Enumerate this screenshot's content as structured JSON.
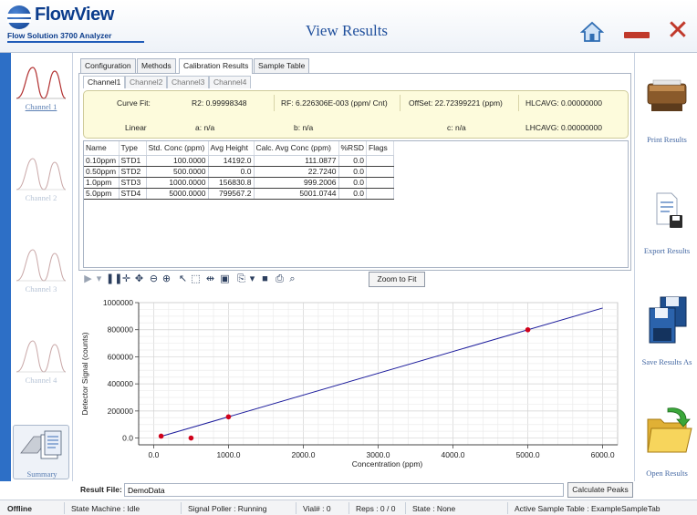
{
  "app": {
    "logo_name": "FlowView",
    "logo_subtitle": "Flow Solution 3700 Analyzer",
    "page_title": "View Results"
  },
  "left_sidebar": {
    "channels": [
      {
        "label": "Channel 1",
        "active": true
      },
      {
        "label": "Channel 2",
        "active": false
      },
      {
        "label": "Channel 3",
        "active": false
      },
      {
        "label": "Channel 4",
        "active": false
      }
    ],
    "summary_label": "Summary"
  },
  "right_sidebar": {
    "print_label": "Print Results",
    "export_label": "Export Results",
    "save_label": "Save Results As",
    "open_label": "Open Results"
  },
  "tabs": [
    "Configuration",
    "Methods",
    "Calibration Results",
    "Sample Table"
  ],
  "active_tab": "Calibration Results",
  "subtabs": [
    "Channel1",
    "Channel2",
    "Channel3",
    "Channel4"
  ],
  "active_subtab": "Channel1",
  "curve": {
    "curve_fit_label": "Curve Fit:",
    "curve_fit_value": "Linear",
    "r2": "R2: 0.99998348",
    "rf": "RF: 6.226306E-003 (ppm/ Cnt)",
    "offset": "OffSet: 22.72399221 (ppm)",
    "hlcavg": "HLCAVG: 0.00000000",
    "a": "a: n/a",
    "b": "b: n/a",
    "c": "c: n/a",
    "lhcavg": "LHCAVG: 0.00000000"
  },
  "table": {
    "columns": [
      "Name",
      "Type",
      "Std. Conc (ppm)",
      "Avg Height",
      "Calc. Avg Conc (ppm)",
      "%RSD",
      "Flags"
    ],
    "rows": [
      [
        "0.10ppm",
        "STD1",
        "100.0000",
        "14192.0",
        "111.0877",
        "0.0",
        ""
      ],
      [
        "0.50ppm",
        "STD2",
        "500.0000",
        "0.0",
        "22.7240",
        "0.0",
        ""
      ],
      [
        "1.0ppm",
        "STD3",
        "1000.0000",
        "156830.8",
        "999.2006",
        "0.0",
        ""
      ],
      [
        "5.0ppm",
        "STD4",
        "5000.0000",
        "799567.2",
        "5001.0744",
        "0.0",
        ""
      ]
    ]
  },
  "toolbar": {
    "zoom_to_fit": "Zoom to Fit"
  },
  "chart_data": {
    "type": "scatter",
    "xlabel": "Concentration (ppm)",
    "ylabel": "Detector Signal (counts)",
    "xlim": [
      -200,
      6200
    ],
    "ylim": [
      -50000,
      1000000
    ],
    "xticks": [
      0,
      1000,
      2000,
      3000,
      4000,
      5000,
      6000
    ],
    "xtick_labels": [
      "0.0",
      "1000.0",
      "2000.0",
      "3000.0",
      "4000.0",
      "5000.0",
      "6000.0"
    ],
    "yticks": [
      0,
      200000,
      400000,
      600000,
      800000,
      1000000
    ],
    "ytick_labels": [
      "0.0",
      "200000",
      "400000",
      "600000",
      "800000",
      "1000000"
    ],
    "grid": true,
    "points": [
      {
        "x": 100,
        "y": 14192
      },
      {
        "x": 500,
        "y": 0
      },
      {
        "x": 1000,
        "y": 156830.8
      },
      {
        "x": 5000,
        "y": 799567.2
      }
    ],
    "fit_line": {
      "x": [
        100,
        6000
      ],
      "y": [
        12411,
        960000
      ]
    },
    "point_color": "#d0021b",
    "line_color": "#1c1c9c"
  },
  "result_file": {
    "label": "Result File:",
    "value": "DemoData",
    "calc_button": "Calculate Peaks"
  },
  "status": {
    "connection": "Offline",
    "state_machine": "State Machine :  Idle",
    "signal_poller": "Signal Poller :  Running",
    "vial": "Vial# :  0",
    "reps": "Reps :  0 / 0",
    "state": "State :  None",
    "active_table": "Active Sample Table :  ExampleSampleTab"
  },
  "colors": {
    "accent": "#2d6fc6",
    "brand": "#0b3c8c",
    "close": "#c0392b"
  }
}
